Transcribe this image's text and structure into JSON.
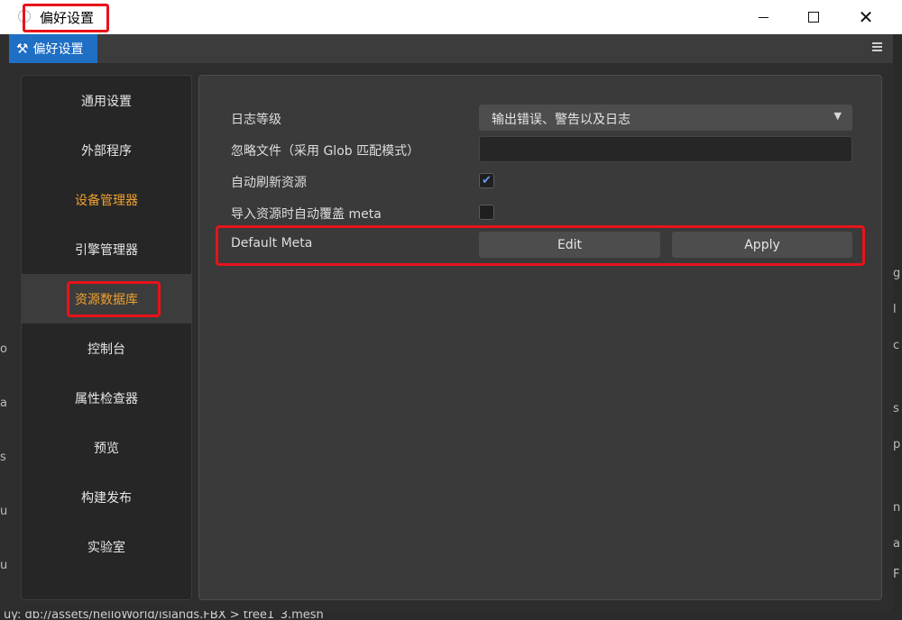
{
  "window": {
    "title": "偏好设置"
  },
  "tab": {
    "label": "偏好设置",
    "icon": "tools-icon"
  },
  "sidebar": {
    "items": [
      {
        "label": "通用设置"
      },
      {
        "label": "外部程序"
      },
      {
        "label": "设备管理器"
      },
      {
        "label": "引擎管理器"
      },
      {
        "label": "资源数据库"
      },
      {
        "label": "控制台"
      },
      {
        "label": "属性检查器"
      },
      {
        "label": "预览"
      },
      {
        "label": "构建发布"
      },
      {
        "label": "实验室"
      }
    ],
    "active_index": 4
  },
  "settings": {
    "log_level": {
      "label": "日志等级",
      "value": "输出错误、警告以及日志"
    },
    "ignore_files": {
      "label": "忽略文件（采用 Glob 匹配模式）",
      "value": ""
    },
    "auto_refresh": {
      "label": "自动刷新资源",
      "checked": true
    },
    "auto_overwrite_meta": {
      "label": "导入资源时自动覆盖 meta",
      "checked": false
    },
    "default_meta": {
      "label": "Default Meta",
      "edit_label": "Edit",
      "apply_label": "Apply"
    }
  },
  "colors": {
    "accent": "#1f6fc5",
    "highlight_orange": "#f0a030",
    "annotation_red": "#e8131b"
  },
  "background_app": {
    "bottom_text": "uy: db://assets/helloWorld/islands.FBX > tree1_3.mesh"
  }
}
